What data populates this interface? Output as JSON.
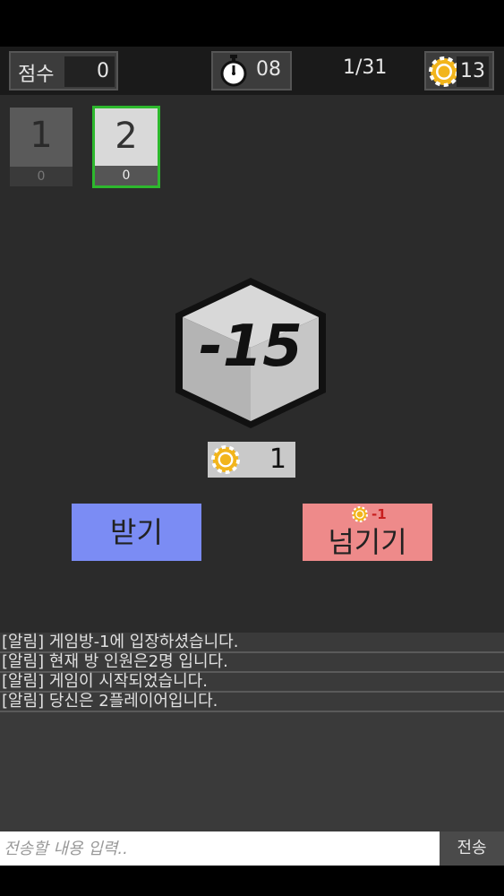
{
  "hud": {
    "score_label": "점수",
    "score_value": "0",
    "timer_value": "08",
    "turn": "1/31",
    "coins": "13"
  },
  "players": [
    {
      "number": "1",
      "points": "0"
    },
    {
      "number": "2",
      "points": "0",
      "active": true
    }
  ],
  "card": {
    "value": "-15"
  },
  "pot": {
    "chips": "1"
  },
  "actions": {
    "take_label": "받기",
    "pass_label": "넘기기",
    "pass_cost": "-1"
  },
  "chat": {
    "messages": [
      "[알림] 게임방-1에 입장하셨습니다.",
      "[알림] 현재 방 인원은2명 입니다.",
      "[알림] 게임이 시작되었습니다.",
      "[알림] 당신은 2플레이어입니다."
    ],
    "placeholder": "전송할 내용 입력..",
    "send_label": "전송"
  },
  "colors": {
    "take": "#7b8cf4",
    "pass": "#ee8a8a",
    "active_player": "#2db82d",
    "coin": "#f2b51c"
  }
}
